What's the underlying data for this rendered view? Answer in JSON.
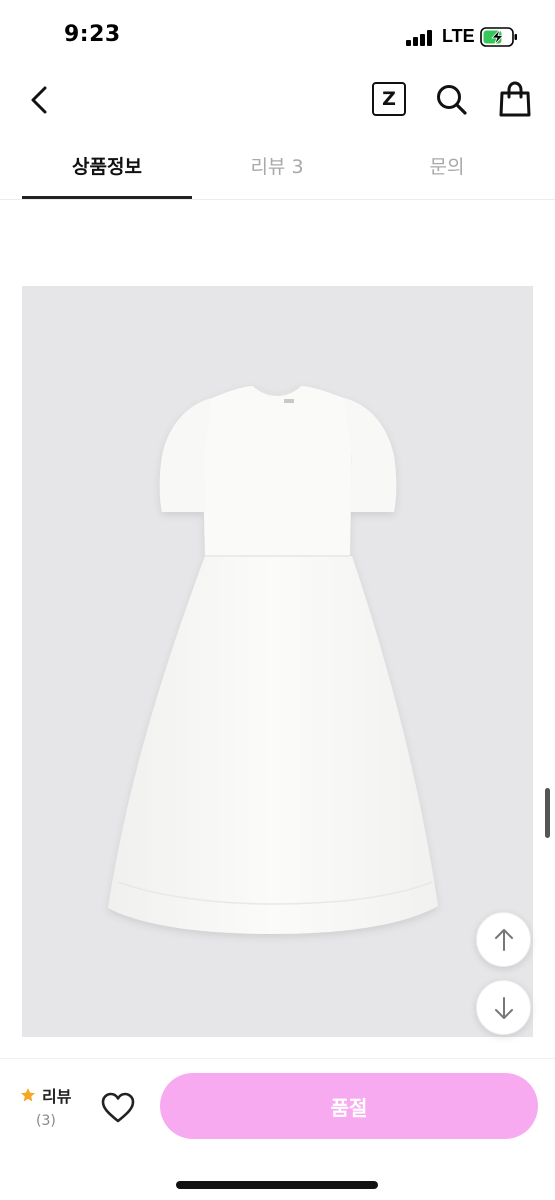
{
  "status_bar": {
    "time": "9:23",
    "network": "LTE",
    "signal_icon": "signal-bars-icon",
    "battery_icon": "battery-charging-icon",
    "battery_color": "#34c759"
  },
  "header": {
    "back_icon": "chevron-left-icon",
    "zigzag_label": "Z",
    "search_icon": "search-icon",
    "bag_icon": "shopping-bag-icon"
  },
  "tabs": [
    {
      "label": "상품정보",
      "active": true
    },
    {
      "label": "리뷰 3",
      "active": false
    },
    {
      "label": "문의",
      "active": false
    }
  ],
  "product_image": {
    "subject": "white-dress-icon",
    "background_color": "#e6e6e8"
  },
  "floating_buttons": {
    "up_icon": "arrow-up-icon",
    "down_icon": "arrow-down-icon"
  },
  "bottom_bar": {
    "review_label": "리뷰",
    "review_count": "(3)",
    "star_icon": "star-icon",
    "star_color": "#f5a623",
    "heart_icon": "heart-icon",
    "soldout_label": "품절",
    "soldout_color": "#f7aaf0"
  }
}
